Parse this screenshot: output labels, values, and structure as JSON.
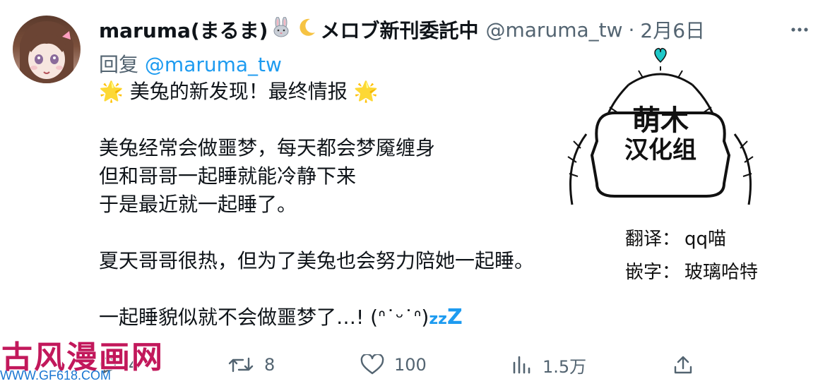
{
  "author": {
    "display_name": "maruma(まるま)",
    "display_name_suffix": "メロブ新刊委託中",
    "handle": "@maruma_tw",
    "date": "2月6日"
  },
  "reply": {
    "prefix": "回复",
    "handle": "@maruma_tw"
  },
  "tweet_lines": [
    "🌟 美兔的新发现！最终情报 🌟",
    "",
    "美兔经常会做噩梦，每天都会梦魇缠身",
    "但和哥哥一起睡就能冷静下来",
    "于是最近就一起睡了。",
    "",
    "夏天哥哥很热，但为了美兔也会努力陪她一起睡。",
    "",
    " 一起睡貌似就不会做噩梦了…! (ᐢ˙ᵕ˙ᐢ)"
  ],
  "zzz": {
    "small1": "z",
    "small2": "z",
    "big": "Z"
  },
  "image": {
    "group_line1": "萌木",
    "group_line2": "汉化组",
    "translate_label": "翻译：",
    "translate_value": "qq喵",
    "typeset_label": "嵌字：",
    "typeset_value": "玻璃哈特"
  },
  "watermark": {
    "title": "古风漫画网",
    "url": "WWW.GF618.COM"
  },
  "actions": {
    "replies": "4",
    "retweets": "8",
    "likes": "100",
    "views": "1.5万"
  },
  "colors": {
    "accent": "#1d9bf0",
    "secondary_text": "#536471",
    "watermark_title": "#c2185b",
    "watermark_url": "#1976d2"
  },
  "icons": [
    "more-icon",
    "rabbit-emoji-icon",
    "moon-emoji-icon",
    "star-emoji-icon",
    "reply-icon",
    "retweet-icon",
    "like-icon",
    "views-icon",
    "share-icon"
  ]
}
